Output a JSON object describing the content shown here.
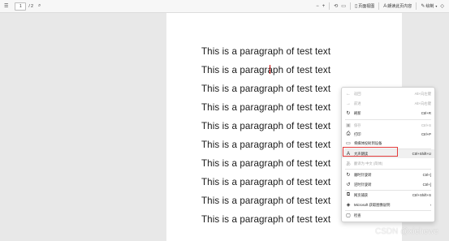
{
  "toolbar": {
    "page_current": "1",
    "page_total": "/ 2",
    "page_view_label": "页面视图",
    "read_aloud_label": "朗读此页内容",
    "draw_label": "绘制"
  },
  "document": {
    "paragraphs": [
      "This is a paragraph of test text",
      "This is a paragraph of test text",
      "This is a paragraph of test text",
      "This is a paragraph of test text",
      "This is a paragraph of test text",
      "This is a paragraph of test text",
      "This is a paragraph of test text",
      "This is a paragraph of test text",
      "This is a paragraph of test text",
      "This is a paragraph of test text"
    ]
  },
  "context_menu": {
    "items": [
      {
        "label": "返回",
        "shortcut": "Alt+向左键"
      },
      {
        "label": "前进",
        "shortcut": "Alt+向右键"
      },
      {
        "label": "刷新",
        "shortcut": "Ctrl+R"
      },
      {
        "label": "保存",
        "shortcut": "Ctrl+S"
      },
      {
        "label": "打印",
        "shortcut": "Ctrl+P"
      },
      {
        "label": "将媒体投射到设备",
        "shortcut": ""
      },
      {
        "label": "大声朗读",
        "shortcut": "Ctrl+Shift+U"
      },
      {
        "label": "翻译为 中文 (简体)",
        "shortcut": ""
      },
      {
        "label": "顺时针旋转",
        "shortcut": "Ctrl+]"
      },
      {
        "label": "逆时针旋转",
        "shortcut": "Ctrl+["
      },
      {
        "label": "网页捕获",
        "shortcut": "Ctrl+Shift+S"
      },
      {
        "label": "Microsoft 获取图像说明",
        "shortcut": ""
      },
      {
        "label": "检查",
        "shortcut": ""
      }
    ]
  },
  "watermark": "CSDN @xiehewe"
}
